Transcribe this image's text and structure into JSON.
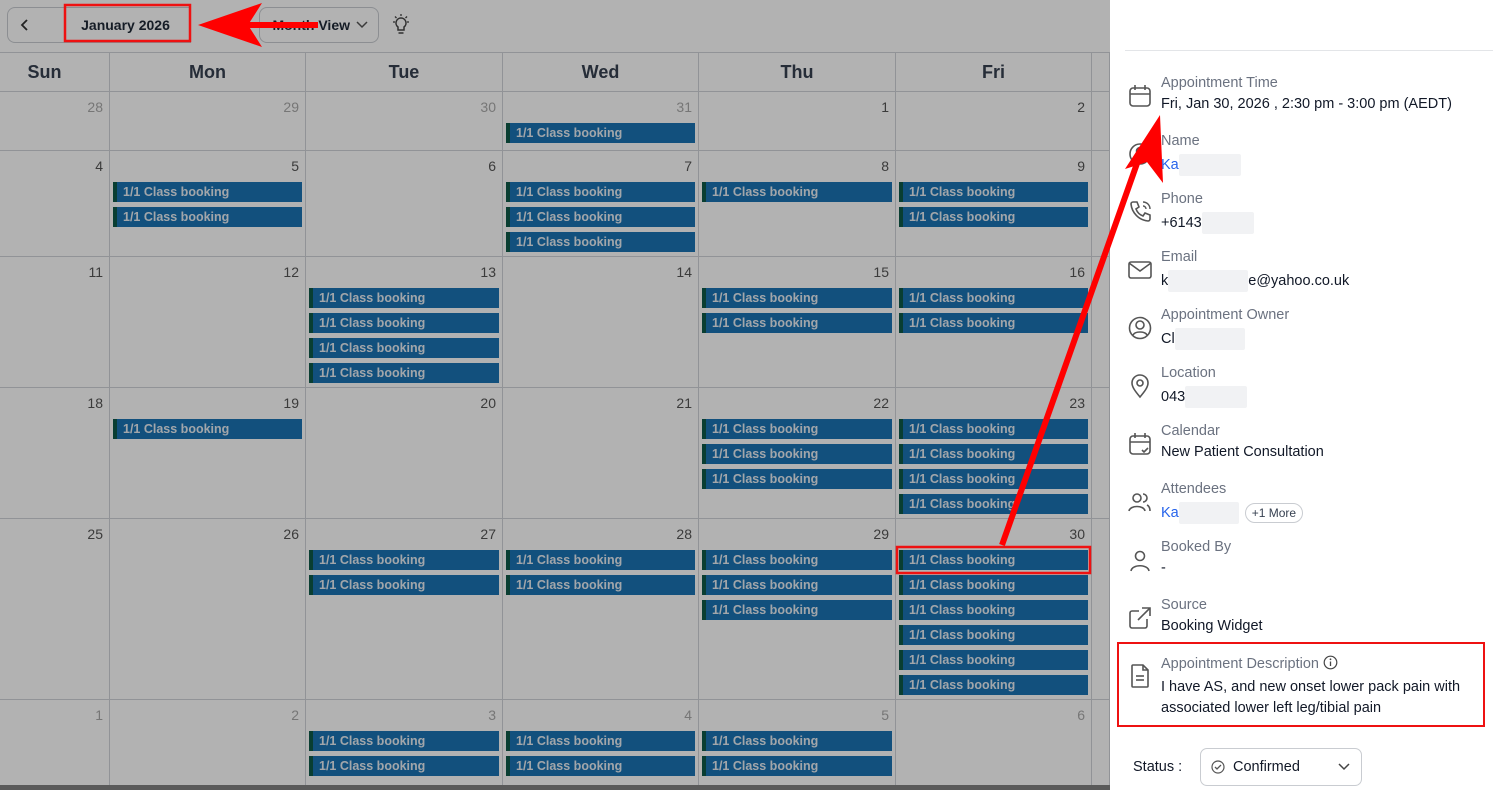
{
  "toolbar": {
    "month": "January 2026",
    "view": "Month View"
  },
  "weekdays": [
    "Sun",
    "Mon",
    "Tue",
    "Wed",
    "Thu",
    "Fri"
  ],
  "event_label": "1/1  Class booking",
  "weeks": [
    {
      "days": [
        {
          "n": "28",
          "other": true,
          "events": 0
        },
        {
          "n": "29",
          "other": true,
          "events": 0
        },
        {
          "n": "30",
          "other": true,
          "events": 0
        },
        {
          "n": "31",
          "other": true,
          "events": 1
        },
        {
          "n": "1",
          "other": false,
          "events": 0
        },
        {
          "n": "2",
          "other": false,
          "events": 0
        }
      ]
    },
    {
      "days": [
        {
          "n": "4",
          "other": false,
          "events": 0
        },
        {
          "n": "5",
          "other": false,
          "events": 2
        },
        {
          "n": "6",
          "other": false,
          "events": 0
        },
        {
          "n": "7",
          "other": false,
          "events": 3
        },
        {
          "n": "8",
          "other": false,
          "events": 1
        },
        {
          "n": "9",
          "other": false,
          "events": 2
        }
      ]
    },
    {
      "days": [
        {
          "n": "11",
          "other": false,
          "events": 0
        },
        {
          "n": "12",
          "other": false,
          "events": 0
        },
        {
          "n": "13",
          "other": false,
          "events": 4
        },
        {
          "n": "14",
          "other": false,
          "events": 0
        },
        {
          "n": "15",
          "other": false,
          "events": 2
        },
        {
          "n": "16",
          "other": false,
          "events": 2
        }
      ]
    },
    {
      "days": [
        {
          "n": "18",
          "other": false,
          "events": 0
        },
        {
          "n": "19",
          "other": false,
          "events": 1
        },
        {
          "n": "20",
          "other": false,
          "events": 0
        },
        {
          "n": "21",
          "other": false,
          "events": 0
        },
        {
          "n": "22",
          "other": false,
          "events": 3
        },
        {
          "n": "23",
          "other": false,
          "events": 4
        }
      ]
    },
    {
      "days": [
        {
          "n": "25",
          "other": false,
          "events": 0
        },
        {
          "n": "26",
          "other": false,
          "events": 0
        },
        {
          "n": "27",
          "other": false,
          "events": 2
        },
        {
          "n": "28",
          "other": false,
          "events": 2
        },
        {
          "n": "29",
          "other": false,
          "events": 3
        },
        {
          "n": "30",
          "other": false,
          "events": 6,
          "highlight": 0
        }
      ]
    },
    {
      "days": [
        {
          "n": "1",
          "other": true,
          "events": 0
        },
        {
          "n": "2",
          "other": true,
          "events": 0
        },
        {
          "n": "3",
          "other": true,
          "events": 2
        },
        {
          "n": "4",
          "other": true,
          "events": 2
        },
        {
          "n": "5",
          "other": true,
          "events": 2
        },
        {
          "n": "6",
          "other": true,
          "events": 0
        }
      ]
    }
  ],
  "panel": {
    "appointment_time": {
      "label": "Appointment Time",
      "value": "Fri, Jan 30, 2026 , 2:30 pm - 3:00 pm (AEDT)"
    },
    "name": {
      "label": "Name",
      "value": "Ka"
    },
    "phone": {
      "label": "Phone",
      "value": "+6143"
    },
    "email": {
      "label": "Email",
      "value_start": "k",
      "value_end": "e@yahoo.co.uk"
    },
    "owner": {
      "label": "Appointment Owner",
      "value": "Cl"
    },
    "location": {
      "label": "Location",
      "value": "043"
    },
    "calendar": {
      "label": "Calendar",
      "value": "New Patient Consultation"
    },
    "attendees": {
      "label": "Attendees",
      "value": "Ka",
      "more": "+1 More"
    },
    "booked_by": {
      "label": "Booked By",
      "value": "-"
    },
    "source": {
      "label": "Source",
      "value": "Booking Widget"
    },
    "description": {
      "label": "Appointment Description",
      "value": "I have AS, and new onset lower pack pain with associated lower left leg/tibial pain"
    },
    "status": {
      "label": "Status :",
      "value": "Confirmed"
    }
  }
}
